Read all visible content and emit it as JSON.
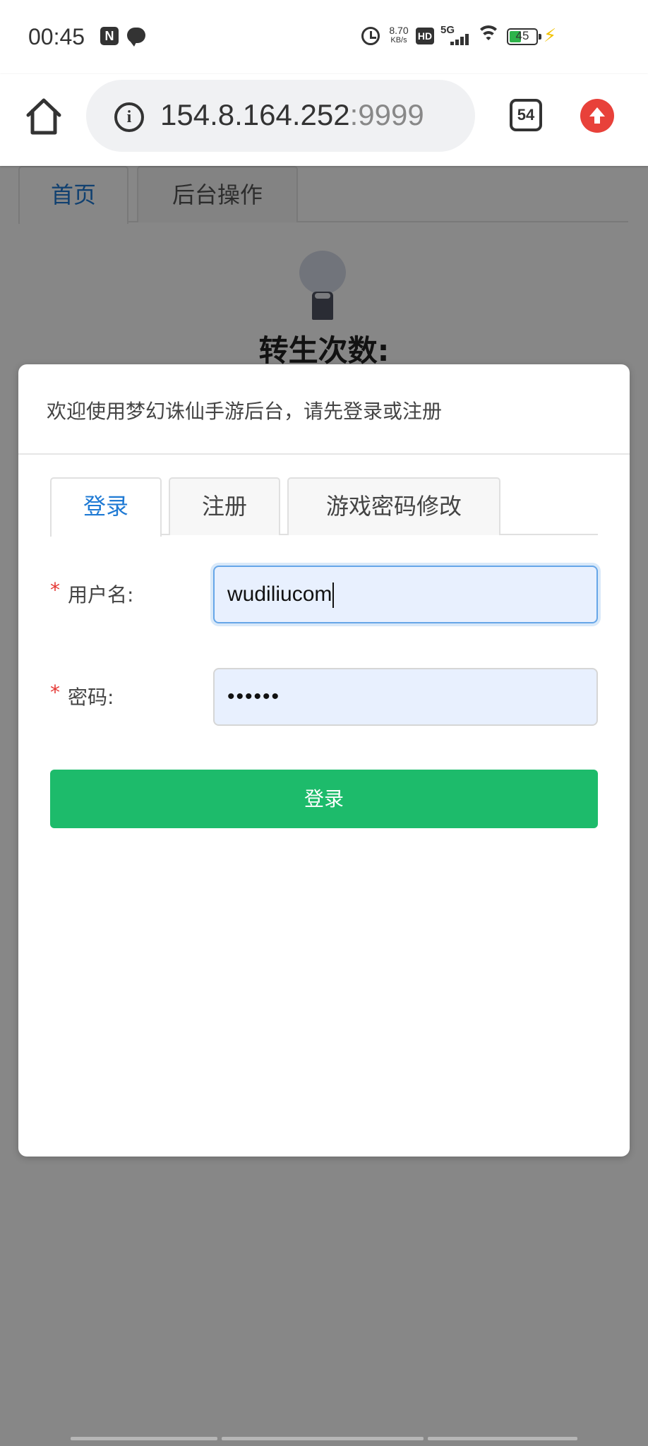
{
  "status_bar": {
    "time": "00:45",
    "nfc_icon_text": "N",
    "speed_value": "8.70",
    "speed_unit": "KB/s",
    "hd_label": "HD",
    "network_label": "5G",
    "battery_percent": "45",
    "battery_level": 0.45
  },
  "browser": {
    "url_host": "154.8.164.252",
    "url_port": ":9999",
    "tab_count": "54",
    "upload_icon": "upload-arrow-icon",
    "upload_color": "#e8413a"
  },
  "page": {
    "tabs": [
      {
        "label": "首页",
        "active": true
      },
      {
        "label": "后台操作",
        "active": false
      }
    ],
    "rebirth_label": "转生次数:"
  },
  "dialog": {
    "title": "欢迎使用梦幻诛仙手游后台，请先登录或注册",
    "tabs": [
      {
        "label": "登录",
        "active": true
      },
      {
        "label": "注册",
        "active": false
      },
      {
        "label": "游戏密码修改",
        "active": false
      }
    ],
    "form": {
      "required_mark": "*",
      "username_label": "用户名:",
      "username_value": "wudiliucom",
      "password_label": "密码:",
      "password_value": "••••••"
    },
    "submit_label": "登录"
  },
  "colors": {
    "accent_blue": "#1f7ad4",
    "submit_green": "#1dbb6b",
    "required_red": "#e53935",
    "input_bg": "#e8f0fe"
  }
}
